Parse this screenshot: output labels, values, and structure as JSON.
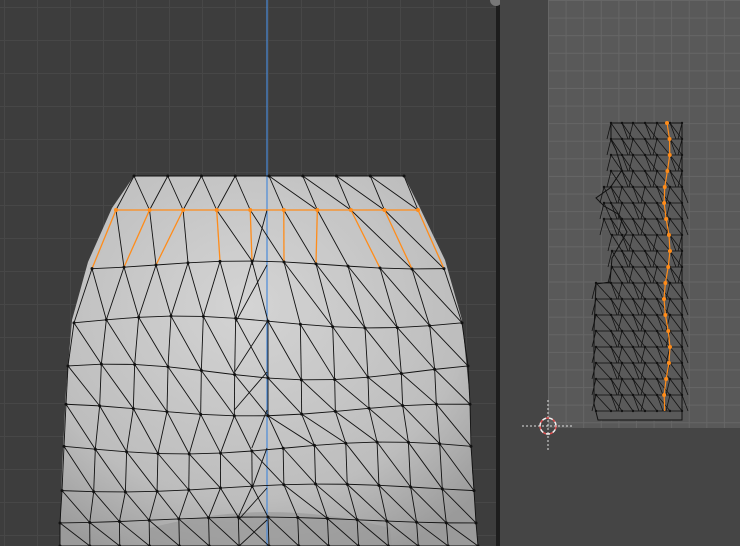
{
  "viewport_3d": {
    "axis_color": "#4a8ad8",
    "selection_color": "#ff8c1a",
    "mesh_color": "#c8c8c8",
    "wire_color": "#111111"
  },
  "uv_editor": {
    "cursor_icon": "2d-cursor-icon",
    "island_color": "#5a5a5a",
    "selection_color": "#ff8c1a"
  }
}
